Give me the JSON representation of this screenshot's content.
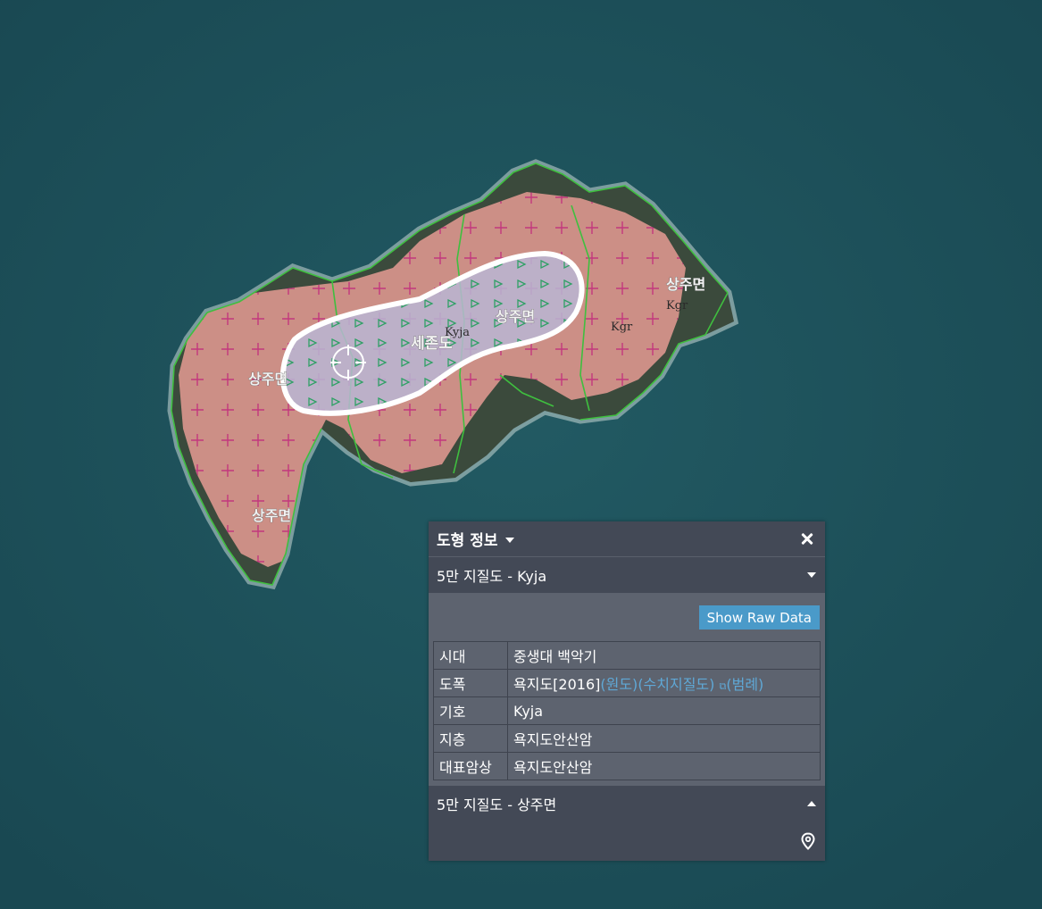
{
  "map": {
    "labels": {
      "sangjumyeon_1": "상주면",
      "sangjumyeon_2": "상주면",
      "sangjumyeon_3": "상주면",
      "sangjumyeon_4": "상주면",
      "sejondo": "세존도",
      "kyja": "Kyja",
      "kgr_1": "Kgr",
      "kgr_2": "Kgr"
    },
    "colors": {
      "sea": "#1d4f5a",
      "island": "#3b4a3c",
      "unit_kgr": "#d7948c",
      "unit_kyja": "#b9b6d4",
      "outline": "#3fbf3f",
      "highlight": "#ffffff",
      "plus_symbol": "#c0207a",
      "triangle_symbol": "#1f9e5a"
    }
  },
  "panel": {
    "title": "도형 정보",
    "close_icon": "close-icon",
    "section1": {
      "title": "5만 지질도 - Kyja",
      "raw_button": "Show Raw Data",
      "rows": [
        {
          "key": "시대",
          "value": "중생대 백악기"
        },
        {
          "key": "도폭",
          "value": "욕지도[2016]",
          "links": [
            "(원도)",
            "(수치지질도)",
            "(범례)"
          ],
          "ext_icon": "external-link-icon"
        },
        {
          "key": "기호",
          "value": "Kyja"
        },
        {
          "key": "지층",
          "value": "욕지도안산암"
        },
        {
          "key": "대표암상",
          "value": "욕지도안산암"
        }
      ]
    },
    "section2": {
      "title": "5만 지질도 - 상주면"
    },
    "footer_icon": "map-pin-icon"
  }
}
